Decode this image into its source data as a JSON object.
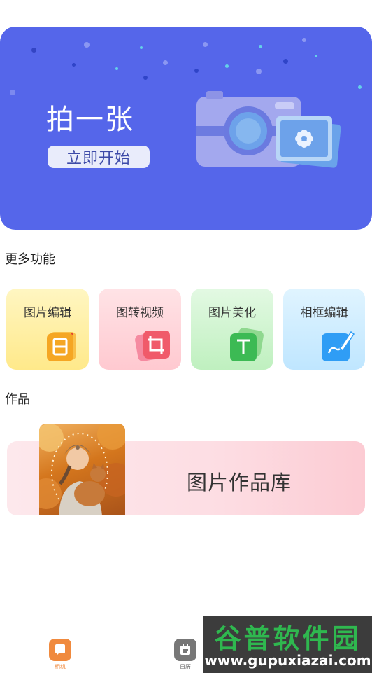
{
  "banner": {
    "title": "拍一张",
    "button_label": "立即开始",
    "background": "#5566ea"
  },
  "more_features": {
    "title": "更多功能",
    "items": [
      {
        "label": "图片编辑",
        "icon": "document-icon",
        "color": "#f5a623"
      },
      {
        "label": "图转视频",
        "icon": "crop-icon",
        "color": "#f05a6a"
      },
      {
        "label": "图片美化",
        "icon": "text-icon",
        "color": "#3cba54"
      },
      {
        "label": "相框编辑",
        "icon": "pen-icon",
        "color": "#2f9df5"
      }
    ]
  },
  "works": {
    "title": "作品",
    "gallery_label": "图片作品库"
  },
  "bottom_nav": {
    "items": [
      {
        "label": "相机",
        "icon": "camera-icon",
        "active": true,
        "color": "#f08a3e"
      },
      {
        "label": "日历",
        "icon": "calendar-icon",
        "active": false,
        "color": "#777777"
      }
    ]
  },
  "watermark": {
    "line1": "谷普软件园",
    "line2": "www.gupuxiazai.com"
  }
}
